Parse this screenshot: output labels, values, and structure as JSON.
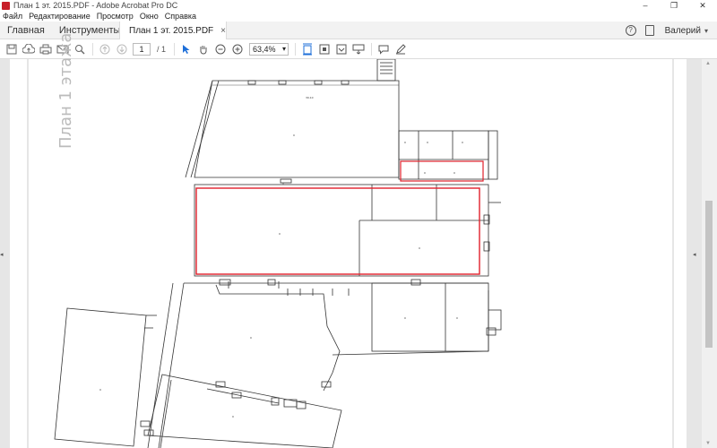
{
  "window": {
    "title": "План 1 эт. 2015.PDF - Adobe Acrobat Pro DC",
    "min": "–",
    "max": "❐",
    "close": "✕"
  },
  "menu": [
    "Файл",
    "Редактирование",
    "Просмотр",
    "Окно",
    "Справка"
  ],
  "tabs": {
    "home": "Главная",
    "tools": "Инструменты",
    "document": "План 1 эт. 2015.PDF",
    "close": "×"
  },
  "user": {
    "name": "Валерий",
    "help": "?"
  },
  "toolbar": {
    "page_current": "1",
    "page_total": "/ 1",
    "zoom": "63,4%"
  },
  "plan": {
    "title": "План 1 этажа"
  },
  "icons": [
    "save-icon",
    "upload-cloud-icon",
    "print-icon",
    "email-icon",
    "search-icon",
    "page-up-icon",
    "page-down-icon",
    "select-cursor-icon",
    "hand-tool-icon",
    "zoom-out-icon",
    "zoom-in-icon",
    "fit-page-icon",
    "full-screen-icon",
    "scroll-mode-icon",
    "comment-icon",
    "pen-icon",
    "help-icon",
    "mobile-link-icon"
  ],
  "colors": {
    "highlight": "#e0202a",
    "accent": "#1e6fd9"
  }
}
